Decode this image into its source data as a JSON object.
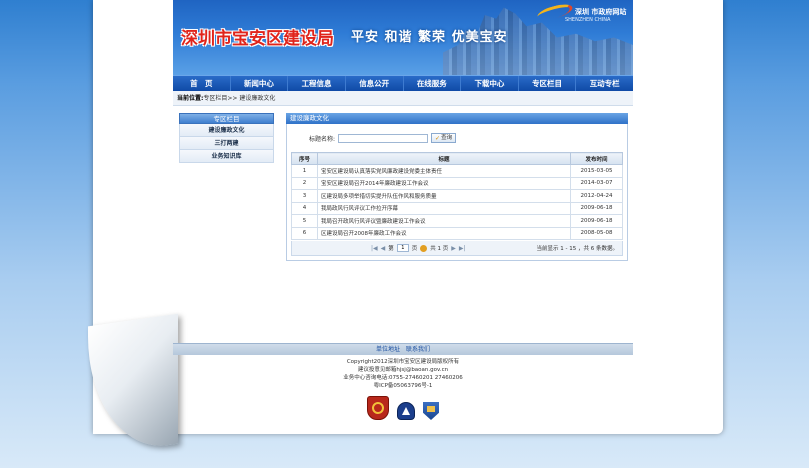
{
  "header": {
    "logo_text": "深圳市宝安区建设局",
    "slogan": "平安 和谐 繁荣 优美宝安",
    "brand_name": "深圳 市政府网站",
    "brand_sub": "SHENZHEN CHINA"
  },
  "nav": {
    "items": [
      "首　页",
      "新闻中心",
      "工程信息",
      "信息公开",
      "在线服务",
      "下载中心",
      "专区栏目",
      "互动专栏"
    ]
  },
  "breadcrumb": {
    "label": "当前位置:",
    "path": "专区栏目>> 建设廉政文化"
  },
  "sidebar": {
    "title": "专区栏目",
    "items": [
      "建设廉政文化",
      "三打两建",
      "业务知识库"
    ]
  },
  "main": {
    "title": "建设廉政文化",
    "search_label": "标题名称:",
    "search_value": "",
    "search_button": "查询",
    "columns": [
      "序号",
      "标题",
      "发布时间"
    ],
    "rows": [
      {
        "no": "1",
        "title": "宝安区建设局认真落实党风廉政建设党委主体责任",
        "date": "2015-03-05"
      },
      {
        "no": "2",
        "title": "宝安区建设局召开2014年廉政建设工作会议",
        "date": "2014-03-07"
      },
      {
        "no": "3",
        "title": "区建设局多项举措切实提升队伍作风和服务质量",
        "date": "2012-04-24"
      },
      {
        "no": "4",
        "title": "我局政风行风评议工作拉开序幕",
        "date": "2009-06-18"
      },
      {
        "no": "5",
        "title": "我局召开政风行风评议暨廉政建设工作会议",
        "date": "2009-06-18"
      },
      {
        "no": "6",
        "title": "区建设局召开2008年廉政工作会议",
        "date": "2008-05-08"
      }
    ],
    "pager": {
      "page_prefix": "第",
      "page_value": "1",
      "page_suffix": "页",
      "total_pages": "共 1 页",
      "summary": "当前显示 1 - 15 ，共 6 条数据。"
    }
  },
  "footer": {
    "links": [
      "单位地址",
      "联系我们"
    ],
    "lines": [
      "Copyright2012深圳市宝安区建设局版权所有",
      "建议投意见邮箱hjsj@baoan.gov.cn",
      "业务中心咨询电话:0755-27460201 27460206",
      "粤ICP备05063796号-1"
    ]
  }
}
